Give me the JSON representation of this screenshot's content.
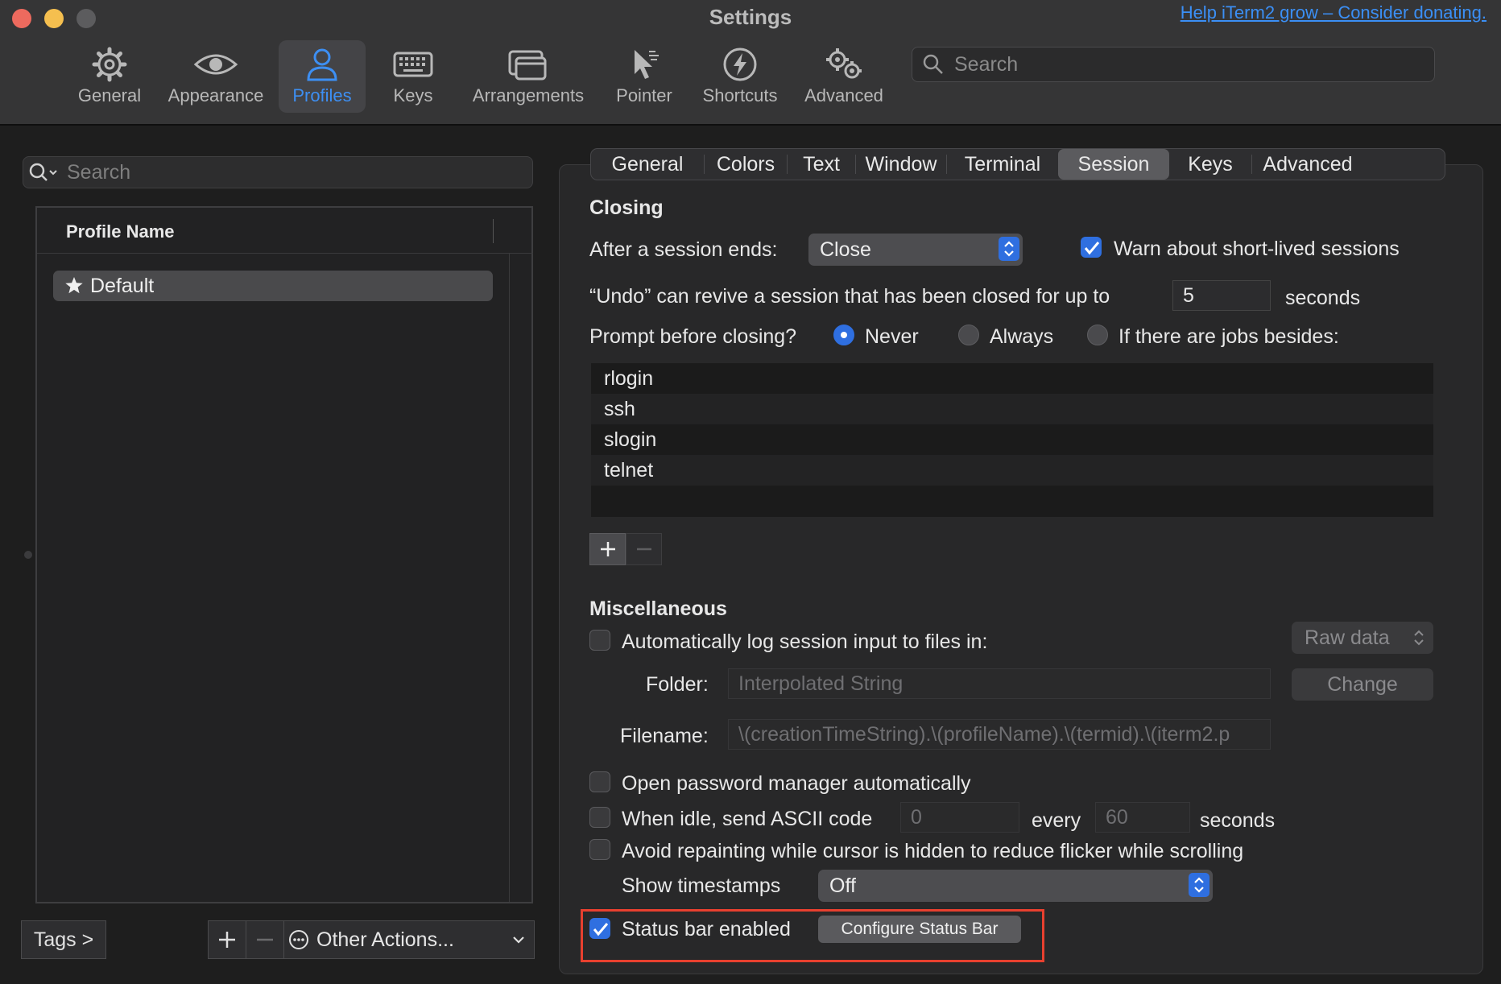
{
  "window": {
    "title": "Settings",
    "donate_link": "Help iTerm2 grow – Consider donating."
  },
  "toolbar": {
    "items": [
      {
        "label": "General",
        "icon": "gear-icon"
      },
      {
        "label": "Appearance",
        "icon": "eye-icon"
      },
      {
        "label": "Profiles",
        "icon": "person-icon",
        "active": true
      },
      {
        "label": "Keys",
        "icon": "keyboard-icon"
      },
      {
        "label": "Arrangements",
        "icon": "windows-icon"
      },
      {
        "label": "Pointer",
        "icon": "pointer-icon"
      },
      {
        "label": "Shortcuts",
        "icon": "lightning-icon"
      },
      {
        "label": "Advanced",
        "icon": "gears-icon"
      }
    ],
    "search_placeholder": "Search"
  },
  "profiles": {
    "search_placeholder": "Search",
    "column_header": "Profile Name",
    "items": [
      {
        "name": "Default",
        "icon": "star-icon"
      }
    ],
    "tags_button": "Tags >",
    "other_actions": "Other Actions..."
  },
  "tabs": [
    {
      "label": "General"
    },
    {
      "label": "Colors"
    },
    {
      "label": "Text"
    },
    {
      "label": "Window"
    },
    {
      "label": "Terminal"
    },
    {
      "label": "Session",
      "active": true
    },
    {
      "label": "Keys"
    },
    {
      "label": "Advanced"
    }
  ],
  "closing": {
    "title": "Closing",
    "after_session_label": "After a session ends:",
    "after_session_value": "Close",
    "warn_short_lived": "Warn about short-lived sessions",
    "warn_short_lived_checked": true,
    "undo_label": "“Undo” can revive a session that has been closed for up to",
    "undo_value": "5",
    "undo_units": "seconds",
    "prompt_label": "Prompt before closing?",
    "prompt_options": [
      "Never",
      "Always",
      "If there are jobs besides:"
    ],
    "prompt_selected": "Never",
    "jobs": [
      "rlogin",
      "ssh",
      "slogin",
      "telnet"
    ]
  },
  "misc": {
    "title": "Miscellaneous",
    "auto_log_label": "Automatically log session input to files in:",
    "auto_log_format": "Raw data",
    "folder_label": "Folder:",
    "folder_placeholder": "Interpolated String",
    "change_button": "Change",
    "filename_label": "Filename:",
    "filename_value": "\\(creationTimeString).\\(profileName).\\(termid).\\(iterm2.p",
    "password_manager_label": "Open password manager automatically",
    "idle_label": "When idle, send ASCII code",
    "idle_code": "0",
    "idle_every": "every",
    "idle_seconds_value": "60",
    "idle_seconds_label": "seconds",
    "avoid_repaint_label": "Avoid repainting while cursor is hidden to reduce flicker while scrolling",
    "timestamps_label": "Show timestamps",
    "timestamps_value": "Off",
    "status_bar_label": "Status bar enabled",
    "status_bar_checked": true,
    "configure_button": "Configure Status Bar"
  },
  "colors": {
    "accent": "#2f6fe0",
    "active_tab_text": "#3d8ff3",
    "highlight": "#e8402f",
    "link": "#3b8ff5"
  }
}
